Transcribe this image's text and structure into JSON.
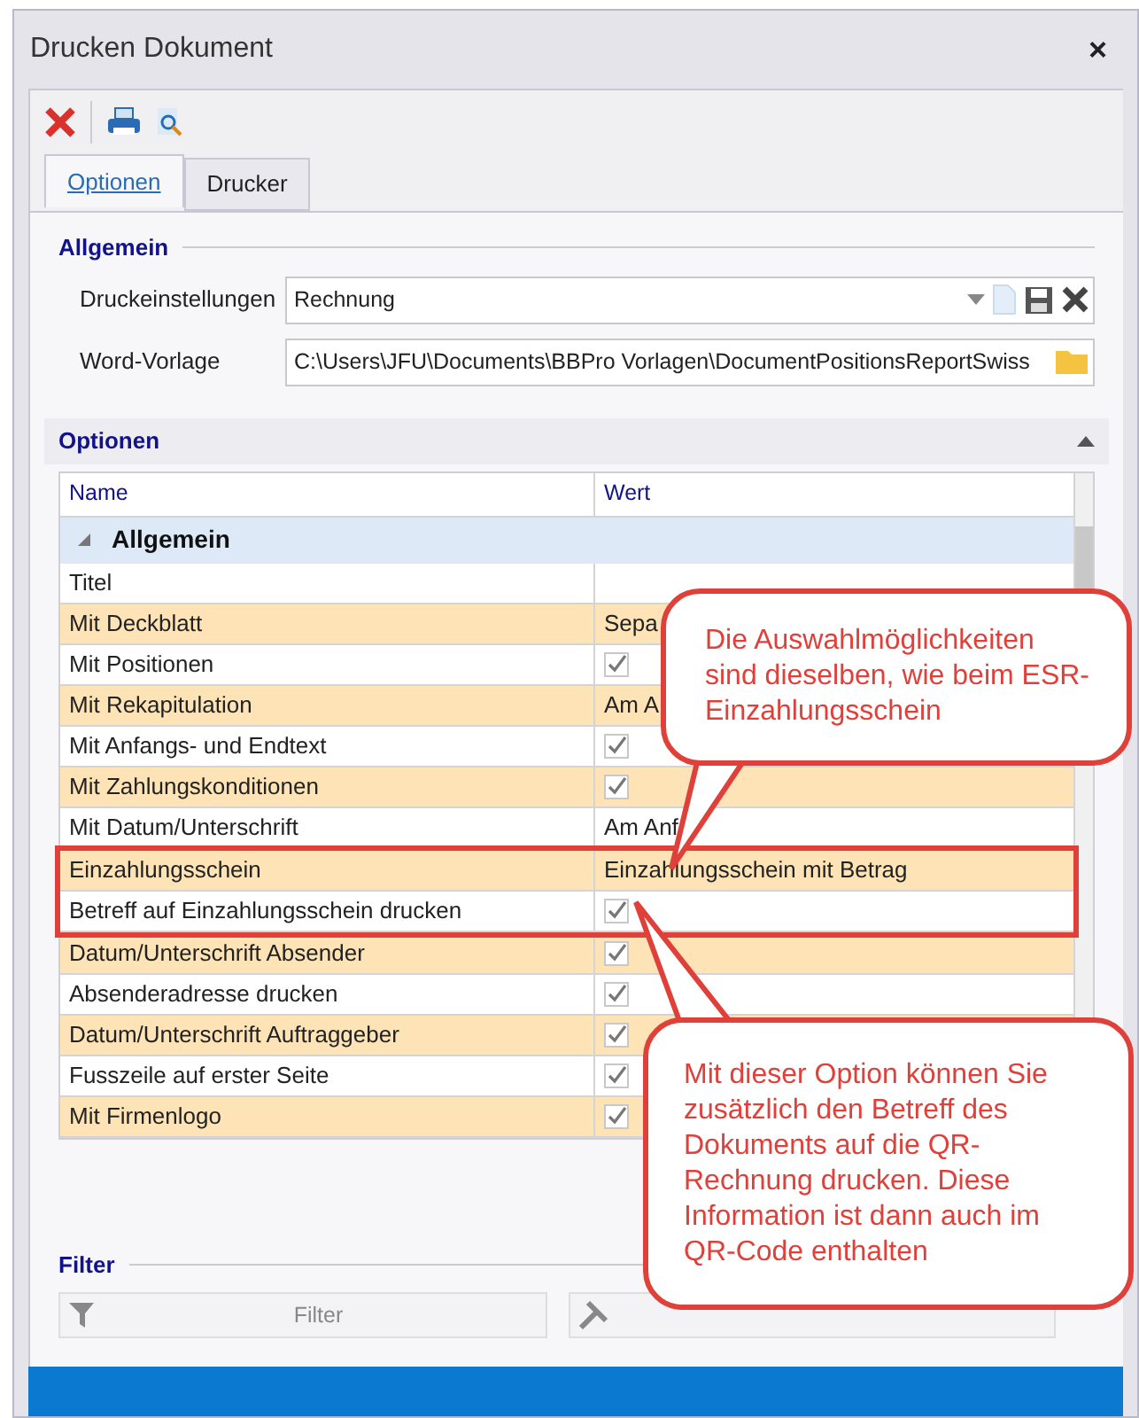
{
  "window": {
    "title": "Drucken Dokument",
    "close": "×"
  },
  "tabs": [
    {
      "label": "Optionen",
      "selected": true
    },
    {
      "label": "Drucker",
      "selected": false
    }
  ],
  "allgemein": {
    "title": "Allgemein",
    "fields": [
      {
        "label": "Druckeinstellungen",
        "value": "Rechnung",
        "kind": "dropdown"
      },
      {
        "label": "Word-Vorlage",
        "value": "C:\\Users\\JFU\\Documents\\BBPro Vorlagen\\DocumentPositionsReportSwiss",
        "kind": "file"
      }
    ]
  },
  "optionen": {
    "title": "Optionen",
    "expanded": true,
    "columns": [
      "Name",
      "Wert"
    ],
    "group": {
      "label": "Allgemein",
      "expanded": true
    },
    "rows": [
      {
        "name": "Titel",
        "kind": "text",
        "value": "",
        "framed": false
      },
      {
        "name": "Mit Deckblatt",
        "kind": "text",
        "value": "Sepa",
        "framed": false
      },
      {
        "name": "Mit Positionen",
        "kind": "check",
        "checked": true,
        "framed": false
      },
      {
        "name": "Mit Rekapitulation",
        "kind": "text",
        "value": "Am A",
        "framed": false
      },
      {
        "name": "Mit Anfangs- und Endtext",
        "kind": "check",
        "checked": true,
        "framed": false
      },
      {
        "name": "Mit Zahlungskonditionen",
        "kind": "check",
        "checked": true,
        "framed": false
      },
      {
        "name": "Mit Datum/Unterschrift",
        "kind": "text",
        "value": "Am Anf",
        "framed": false
      },
      {
        "name": "Einzahlungsschein",
        "kind": "text",
        "value": "Einzahlungsschein mit Betrag",
        "framed": true
      },
      {
        "name": "Betreff auf Einzahlungsschein drucken",
        "kind": "check",
        "checked": true,
        "framed": true
      },
      {
        "name": "Datum/Unterschrift Absender",
        "kind": "check",
        "checked": true,
        "framed": false
      },
      {
        "name": "Absenderadresse drucken",
        "kind": "check",
        "checked": true,
        "framed": false
      },
      {
        "name": "Datum/Unterschrift Auftraggeber",
        "kind": "check",
        "checked": true,
        "framed": false
      },
      {
        "name": "Fusszeile auf erster Seite",
        "kind": "check",
        "checked": true,
        "framed": false
      },
      {
        "name": "Mit Firmenlogo",
        "kind": "check",
        "checked": true,
        "framed": false
      }
    ]
  },
  "filter": {
    "title": "Filter",
    "buttons": [
      {
        "label": "Filter",
        "kind": "filter"
      },
      {
        "kind": "tools"
      }
    ]
  },
  "callouts": [
    {
      "text": "Die Auswahlmöglichkeiten sind dieselben, wie beim ESR-Einzahlungsschein",
      "kind": "down"
    },
    {
      "text": "Mit dieser Option können Sie zusätzlich den Betreff des Dokuments auf die QR-Rechnung drucken. Diese Information ist dann auch im QR-Code enthalten",
      "kind": "up"
    }
  ]
}
